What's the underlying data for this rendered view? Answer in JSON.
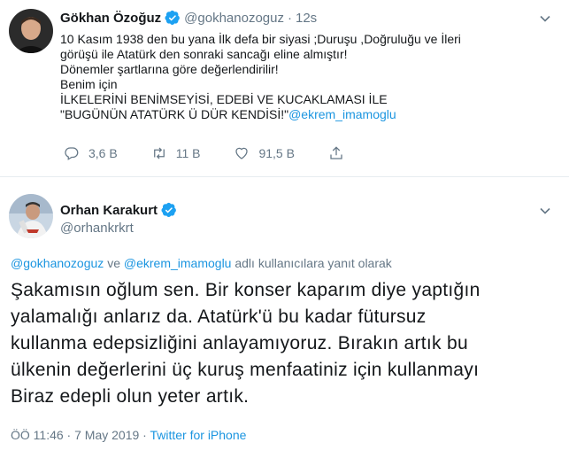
{
  "tweet1": {
    "name": "Gökhan Özoğuz",
    "handle": "@gokhanozoguz",
    "separator": "·",
    "time": "12s",
    "lines": [
      "10 Kasım 1938 den bu yana İlk defa bir siyasi ;Duruşu ,Doğruluğu ve İleri",
      "görüşü ile Atatürk den sonraki sancağı eline almıştır!",
      "Dönemler şartlarına göre değerlendirilir!",
      "Benim için",
      "İLKELERİNİ BENİMSEYİSİ, EDEBİ VE KUCAKLAMASI İLE"
    ],
    "last_line_text": "\"BUGÜNÜN ATATÜRK Ü DÜR KENDİSİ!\"",
    "last_line_mention": "@ekrem_imamoglu",
    "replies": "3,6 B",
    "retweets": "11 B",
    "likes": "91,5 B"
  },
  "tweet2": {
    "name": "Orhan Karakurt",
    "handle": "@orhankrkrt",
    "reply_mention1": "@gokhanozoguz",
    "reply_and": "ve",
    "reply_mention2": "@ekrem_imamoglu",
    "reply_suffix": "adlı kullanıcılara yanıt olarak",
    "lines": [
      "Şakamısın oğlum sen. Bir konser kaparım diye yaptığın",
      "yalamalığı anlarız da. Atatürk'ü bu kadar fütursuz",
      "kullanma edepsizliğini anlayamıyoruz. Bırakın artık bu",
      "ülkenin değerlerini üç kuruş menfaatiniz için kullanmayı",
      "Biraz edepli olun yeter artık."
    ],
    "time_date": "ÖÖ 11:46 · 7 May 2019 ·",
    "source": "Twitter for iPhone"
  },
  "colors": {
    "accent": "#1b95e0",
    "muted": "#657786",
    "text": "#14171a"
  },
  "icons": [
    "verified-badge-icon",
    "chevron-down-icon",
    "reply-icon",
    "retweet-icon",
    "like-icon",
    "share-icon"
  ]
}
